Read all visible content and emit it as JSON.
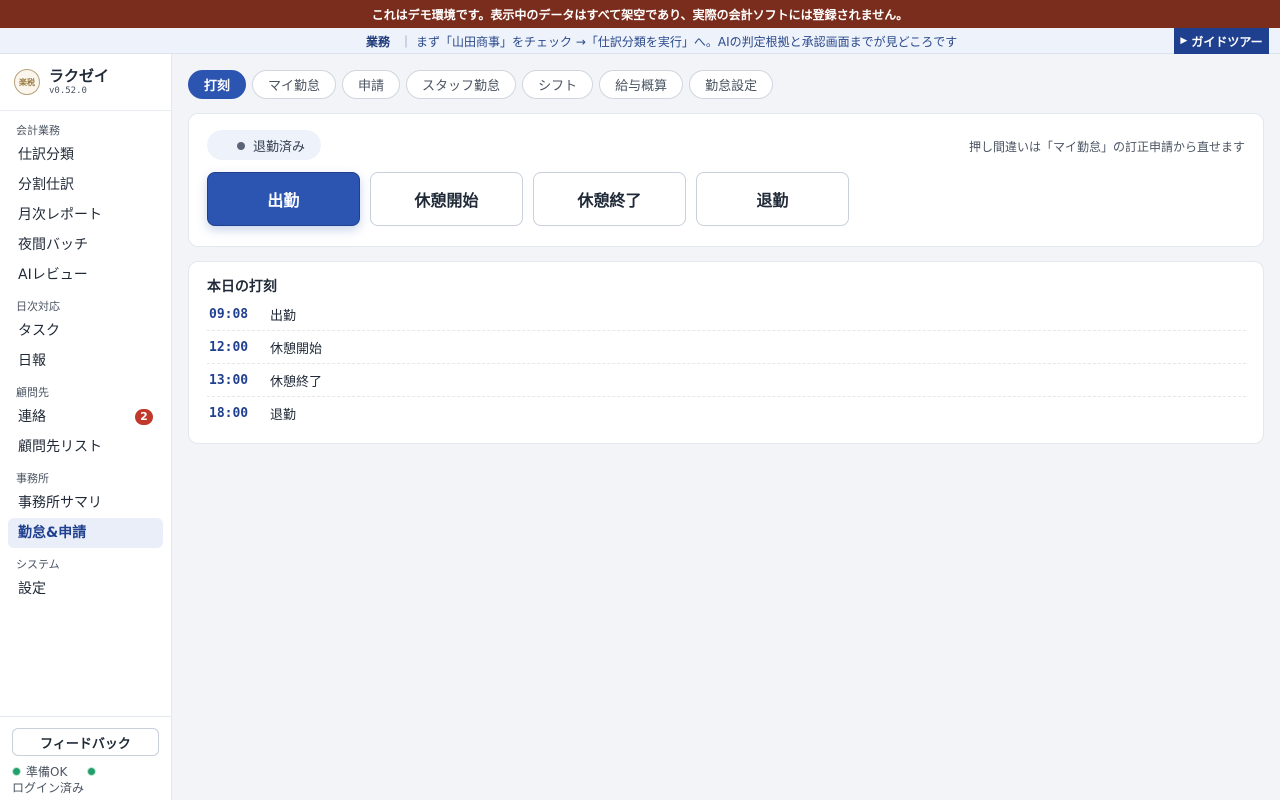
{
  "demo_banner": "これはデモ環境です。表示中のデータはすべて架空であり、実際の会計ソフトには登録されません。",
  "guide": {
    "category": "業務",
    "separator": "｜",
    "text": "まず「山田商事」をチェック →「仕訳分類を実行」へ。AIの判定根拠と承認画面までが見どころです",
    "tour_button": "ガイドツアー",
    "tour_icon": "play-triangle-icon"
  },
  "brand": {
    "logo_text": "楽税",
    "name": "ラクゼイ",
    "version": "v0.52.0"
  },
  "sidebar": {
    "sections": [
      {
        "title": "会計業務",
        "items": [
          {
            "label": "仕訳分類"
          },
          {
            "label": "分割仕訳"
          },
          {
            "label": "月次レポート"
          },
          {
            "label": "夜間バッチ"
          },
          {
            "label": "AIレビュー"
          }
        ]
      },
      {
        "title": "日次対応",
        "items": [
          {
            "label": "タスク"
          },
          {
            "label": "日報"
          }
        ]
      },
      {
        "title": "顧問先",
        "items": [
          {
            "label": "連絡",
            "badge": "2"
          },
          {
            "label": "顧問先リスト"
          }
        ]
      },
      {
        "title": "事務所",
        "items": [
          {
            "label": "事務所サマリ"
          },
          {
            "label": "勤怠&申請",
            "active": true
          }
        ]
      },
      {
        "title": "システム",
        "items": [
          {
            "label": "設定"
          }
        ]
      }
    ],
    "feedback_button": "フィードバック",
    "status_ready": "準備OK",
    "status_login": "ログイン済み"
  },
  "tabs": [
    {
      "label": "打刻",
      "active": true
    },
    {
      "label": "マイ勤怠"
    },
    {
      "label": "申請"
    },
    {
      "label": "スタッフ勤怠"
    },
    {
      "label": "シフト"
    },
    {
      "label": "給与概算"
    },
    {
      "label": "勤怠設定"
    }
  ],
  "punch_card": {
    "state": "退勤済み",
    "hint": "押し間違いは「マイ勤怠」の訂正申請から直せます",
    "buttons": {
      "clock_in": "出勤",
      "break_start": "休憩開始",
      "break_end": "休憩終了",
      "clock_out": "退勤"
    }
  },
  "today_log": {
    "title": "本日の打刻",
    "entries": [
      {
        "time": "09:08",
        "label": "出勤"
      },
      {
        "time": "12:00",
        "label": "休憩開始"
      },
      {
        "time": "13:00",
        "label": "休憩終了"
      },
      {
        "time": "18:00",
        "label": "退勤"
      }
    ]
  },
  "colors": {
    "banner": "#7b2d1d",
    "accent": "#2b55b0",
    "badge": "#c0392b",
    "status_ok": "#22a06b"
  }
}
